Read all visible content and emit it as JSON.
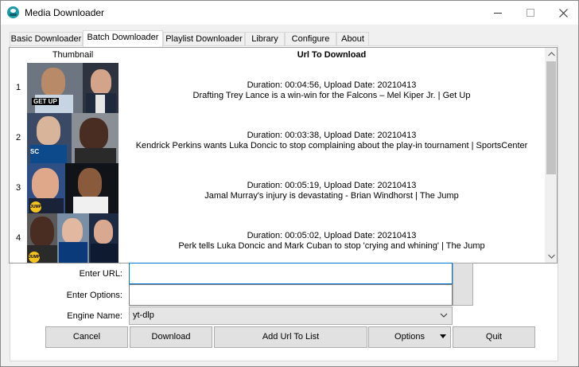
{
  "window": {
    "title": "Media Downloader"
  },
  "tabs": [
    {
      "label": "Basic Downloader",
      "active": false
    },
    {
      "label": "Batch Downloader",
      "active": true
    },
    {
      "label": "Playlist Downloader",
      "active": false
    },
    {
      "label": "Library",
      "active": false
    },
    {
      "label": "Configure",
      "active": false
    },
    {
      "label": "About",
      "active": false
    }
  ],
  "table": {
    "headers": {
      "thumbnail": "Thumbnail",
      "url": "Url To Download"
    },
    "rows": [
      {
        "num": "1",
        "info": "Duration: 00:04:56, Upload Date: 20210413",
        "title": "Drafting Trey Lance is a win-win for the Falcons – Mel Kiper Jr. | Get Up",
        "thumb_caption": "GET UP"
      },
      {
        "num": "2",
        "info": "Duration: 00:03:38, Upload Date: 20210413",
        "title": "Kendrick Perkins wants Luka Doncic to stop complaining about the play-in tournament | SportsCenter",
        "thumb_caption": "SC"
      },
      {
        "num": "3",
        "info": "Duration: 00:05:19, Upload Date: 20210413",
        "title": "Jamal Murray's injury is devastating - Brian Windhorst | The Jump",
        "thumb_caption": "JUMP"
      },
      {
        "num": "4",
        "info": "Duration: 00:05:02, Upload Date: 20210413",
        "title": "Perk tells Luka Doncic and Mark Cuban to stop 'crying and whining' | The Jump",
        "thumb_caption": "JUMP"
      }
    ]
  },
  "form": {
    "url_label": "Enter URL:",
    "url_value": "",
    "options_label": "Enter Options:",
    "options_value": "",
    "engine_label": "Engine Name:",
    "engine_value": "yt-dlp"
  },
  "buttons": {
    "cancel": "Cancel",
    "download": "Download",
    "add_url": "Add Url To List",
    "options": "Options",
    "quit": "Quit"
  },
  "colors": {
    "accent": "#0078d7",
    "app_icon": "#1a9aa8"
  }
}
